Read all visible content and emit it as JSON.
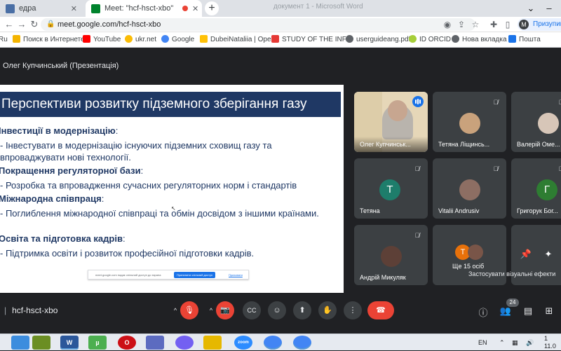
{
  "browser": {
    "tabs": [
      {
        "title": "едра",
        "favicon_color": "#4a6fa5",
        "active": false
      },
      {
        "title": "Meet: \"hcf-hsct-xbo\"",
        "favicon_color": "#00832d",
        "active": true,
        "recording": true
      }
    ],
    "new_tab_glyph": "+",
    "ghost_tab_text": "документ 1 - Microsoft Word",
    "address": {
      "url": "meet.google.com/hcf-hsct-xbo"
    },
    "profile": {
      "initial": "M",
      "label": "Призупинено"
    },
    "bookmarks": [
      {
        "label": "Ru",
        "icon_color": "#4285f4"
      },
      {
        "label": "Поиск в Интернете",
        "icon_color": "#f4b400"
      },
      {
        "label": "YouTube",
        "icon_color": "#ff0000"
      },
      {
        "label": "ukr.net",
        "icon_color": "#fbbc05"
      },
      {
        "label": "Google",
        "icon_color": "#4285f4"
      },
      {
        "label": "DubeiNataliia | Ope...",
        "icon_color": "#ffc107"
      },
      {
        "label": "STUDY OF THE INF...",
        "icon_color": "#e53935"
      },
      {
        "label": "userguideang.pdf",
        "icon_color": "#5f6368"
      },
      {
        "label": "ID ORCID",
        "icon_color": "#a6ce39"
      },
      {
        "label": "Нова вкладка",
        "icon_color": "#5f6368"
      },
      {
        "label": "Пошта",
        "icon_color": "#1a73e8"
      }
    ]
  },
  "meet": {
    "presenter_title": "Олег Купчинський (Презентація)",
    "slide": {
      "title": "Перспективи розвитку підземного зберігання газу",
      "sections": [
        {
          "heading": "Інвестиції в модернізацію",
          "suffix": ":",
          "bullet": "- Інвестувати в модернізацію існуючих підземних сховищ газу та впроваджувати нові технології."
        },
        {
          "heading": "Покращення регуляторної бази",
          "suffix": ":",
          "bullet": "- Розробка та впровадження сучасних регуляторних норм і стандартів"
        },
        {
          "heading": "Міжнародна співпраця",
          "suffix": ":",
          "bullet": "- Поглиблення міжнародної співпраці та обмін досвідом з іншими країнами."
        },
        {
          "heading": "Освіта та підготовка кадрів",
          "suffix": ":",
          "bullet": "- Підтримка освіти і розвиток професійної підготовки кадрів."
        }
      ],
      "share_banner": {
        "text": "meet.google.com надає спільний доступ до екрана",
        "stop_label": "Припинити спільний доступ",
        "hide_label": "Приховати"
      }
    },
    "participants": [
      {
        "name": "Олег Купчинськ...",
        "type": "video",
        "speaking": true
      },
      {
        "name": "Тетяна Ліщинсь...",
        "type": "photo",
        "muted": true,
        "avatar_color": "#c9a27c"
      },
      {
        "name": "Валерій Оме...",
        "type": "photo",
        "muted": true,
        "avatar_color": "#d7c6b8"
      },
      {
        "name": "Тетяна",
        "type": "letter",
        "letter": "Т",
        "muted": true,
        "avatar_color": "#1e7d6b"
      },
      {
        "name": "Vitalii Andrusiv",
        "type": "photo",
        "muted": true,
        "avatar_color": "#8d6e63"
      },
      {
        "name": "Григорук Бог...",
        "type": "letter",
        "letter": "Г",
        "muted": true,
        "avatar_color": "#2e7d32"
      },
      {
        "name": "Андрій Микуляк",
        "type": "photo",
        "muted": true,
        "avatar_color": "#5d4037"
      },
      {
        "name": "Ще 15 осіб",
        "type": "more",
        "letter": "Т",
        "avatar_color": "#e8710a",
        "avatar_color_2": "#795548"
      },
      {
        "name": "",
        "type": "effects"
      }
    ],
    "effects_tooltip": "Застосувати візуальні ефекти",
    "meeting_code": "hcf-hsct-xbo",
    "participant_count": "24",
    "controls": {
      "caret": "^",
      "mic_glyph": "🎙",
      "cam_glyph": "📷",
      "cc_glyph": "CC",
      "emoji_glyph": "☺",
      "present_glyph": "⬆",
      "hand_glyph": "✋",
      "more_glyph": "⋮",
      "hangup_glyph": "☎",
      "info_glyph": "ⓘ",
      "people_glyph": "👥",
      "chat_glyph": "▤",
      "activities_glyph": "⊞",
      "pin_glyph": "📌",
      "sparkle_glyph": "✦"
    }
  },
  "taskbar": {
    "apps": [
      {
        "label": "",
        "color": "#3c8dde"
      },
      {
        "label": "",
        "color": "#6b8e23"
      },
      {
        "label": "W",
        "color": "#2b579a",
        "open": true
      },
      {
        "label": "µ",
        "color": "#4caf50"
      },
      {
        "label": "O",
        "color": "#cc0f16"
      },
      {
        "label": "",
        "color": "#5c6bc0"
      },
      {
        "label": "",
        "color": "#7360f2"
      },
      {
        "label": "",
        "color": "#e6b800"
      },
      {
        "label": "zoom",
        "color": "#2d8cff"
      },
      {
        "label": "",
        "color": "#4285f4",
        "open": true
      },
      {
        "label": "",
        "color": "#4285f4",
        "open": true
      }
    ],
    "lang": "EN",
    "clock_time": "1",
    "clock_date": "11.0"
  }
}
